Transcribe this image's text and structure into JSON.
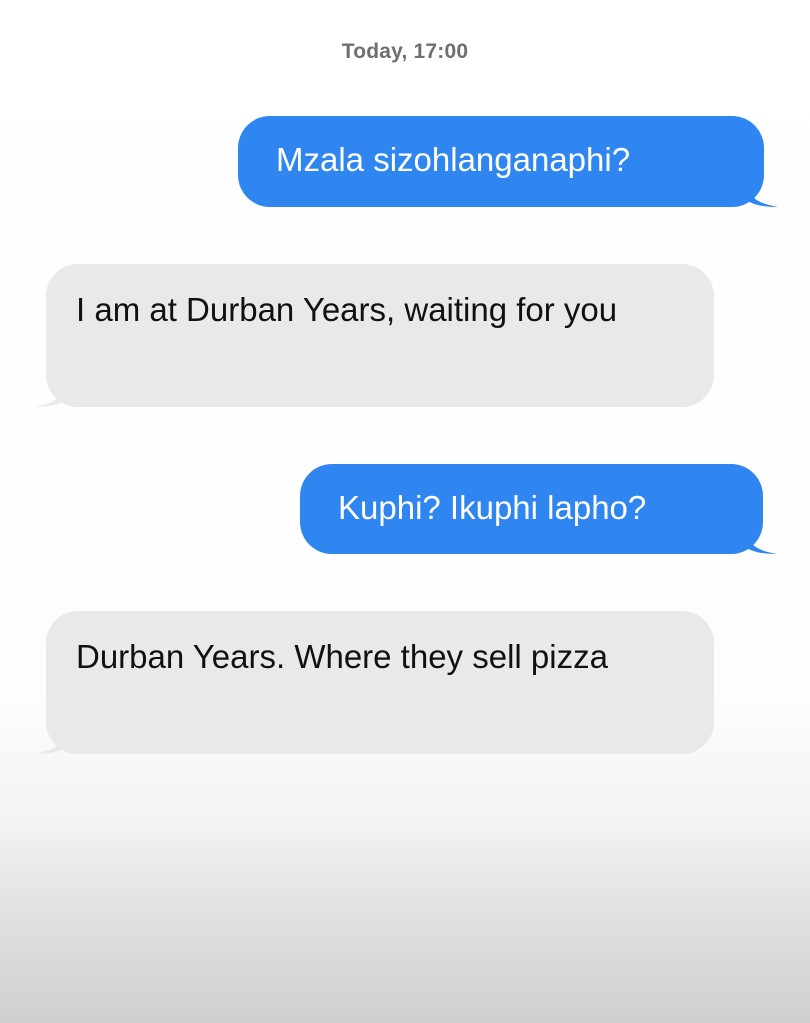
{
  "conversation": {
    "timestamp": "Today, 17:00",
    "messages": [
      {
        "direction": "sent",
        "text": "Mzala sizohlanganaphi?"
      },
      {
        "direction": "received",
        "text": "I am at Durban Years, waiting for you"
      },
      {
        "direction": "sent",
        "text": "Kuphi? Ikuphi lapho?"
      },
      {
        "direction": "received",
        "text": "Durban Years. Where they sell pizza"
      }
    ]
  },
  "colors": {
    "sent_bubble": "#2f86f1",
    "received_bubble": "#e9e9eb",
    "timestamp_text": "#6f6f6f"
  }
}
